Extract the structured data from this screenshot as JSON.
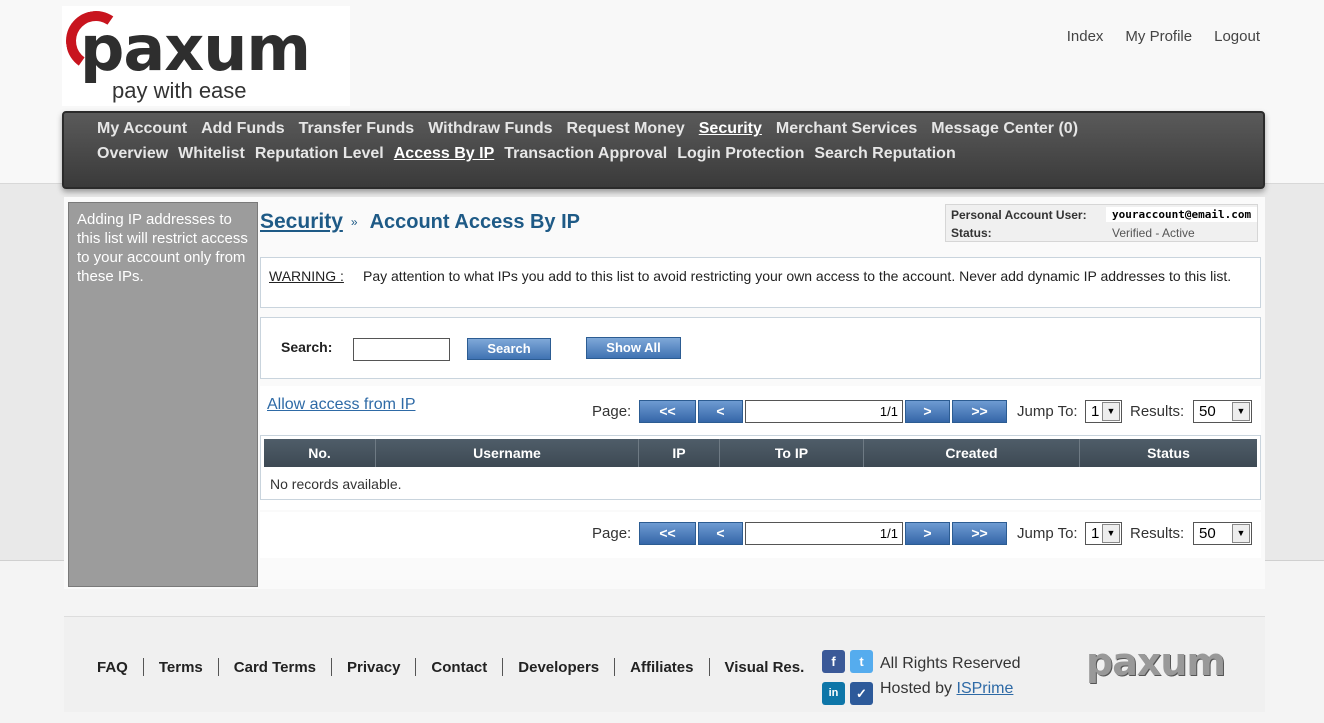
{
  "brand": {
    "name": "paxum",
    "tagline": "pay with ease"
  },
  "top_links": [
    {
      "label": "Index"
    },
    {
      "label": "My Profile"
    },
    {
      "label": "Logout"
    }
  ],
  "nav": {
    "row1": [
      {
        "label": "My Account",
        "active": false
      },
      {
        "label": "Add Funds",
        "active": false
      },
      {
        "label": "Transfer Funds",
        "active": false
      },
      {
        "label": "Withdraw Funds",
        "active": false
      },
      {
        "label": "Request Money",
        "active": false
      },
      {
        "label": "Security",
        "active": true
      },
      {
        "label": "Merchant Services",
        "active": false
      },
      {
        "label": "Message Center (0)",
        "active": false
      }
    ],
    "row2": [
      {
        "label": "Overview",
        "active": false
      },
      {
        "label": "Whitelist",
        "active": false
      },
      {
        "label": "Reputation Level",
        "active": false
      },
      {
        "label": "Access By IP",
        "active": true
      },
      {
        "label": "Transaction Approval",
        "active": false
      },
      {
        "label": "Login Protection",
        "active": false
      },
      {
        "label": "Search Reputation",
        "active": false
      }
    ]
  },
  "sidebar": {
    "text": "Adding IP addresses to this list will restrict access to your account only from these IPs."
  },
  "breadcrumb": {
    "parent": "Security",
    "separator": "»",
    "title": "Account Access By IP"
  },
  "account": {
    "user_label": "Personal Account User:",
    "user_value": "youraccount@email.com",
    "status_label": "Status:",
    "status_value": "Verified - Active"
  },
  "warning": {
    "label": "WARNING :",
    "text": "Pay attention to what IPs you add to this list to avoid restricting your own access to the account. Never add dynamic IP addresses to this list."
  },
  "search": {
    "label": "Search:",
    "value": "",
    "search_button": "Search",
    "show_all_button": "Show All"
  },
  "allow_link": "Allow access from IP",
  "pager": {
    "page_label": "Page:",
    "first": "<<",
    "prev": "<",
    "next": ">",
    "last": ">>",
    "page_info": "1/1",
    "jump_label": "Jump To:",
    "jump_value": "1",
    "results_label": "Results:",
    "results_value": "50"
  },
  "table": {
    "columns": [
      "No.",
      "Username",
      "IP",
      "To IP",
      "Created",
      "Status"
    ],
    "empty_text": "No records available."
  },
  "footer": {
    "links": [
      "FAQ",
      "Terms",
      "Card Terms",
      "Privacy",
      "Contact",
      "Developers",
      "Affiliates",
      "Visual Res."
    ],
    "social_icons": [
      "facebook-icon",
      "twitter-icon",
      "linkedin-icon",
      "delicious-icon"
    ],
    "rights": "All Rights Reserved",
    "hosted_by": "Hosted by",
    "host_link": "ISPrime",
    "logo": "paxum"
  },
  "colors": {
    "nav_bg": "#3a3a3a",
    "heading_blue": "#1e5a86",
    "button_blue": "#3f72b2",
    "brand_red": "#c8141e",
    "sidebar_gray": "#9c9c9c"
  }
}
